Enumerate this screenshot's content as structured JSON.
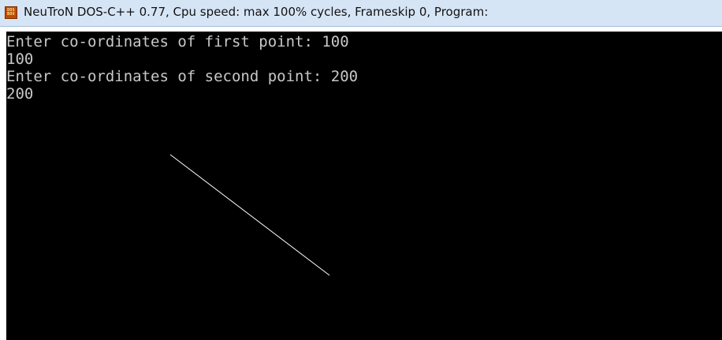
{
  "window": {
    "title": "NeuTroN DOS-C++ 0.77, Cpu speed: max 100% cycles, Frameskip  0, Program:",
    "icon": "dosbox-icon",
    "icon_text": [
      "DOS",
      "BOX"
    ]
  },
  "console": {
    "lines": [
      "Enter co-ordinates of first point: 100",
      "100",
      "Enter co-ordinates of second point: 200",
      "200"
    ],
    "text_color": "#c8c8c8",
    "background_color": "#000000"
  },
  "drawing": {
    "shape": "line",
    "line_color": "#ffffff"
  }
}
